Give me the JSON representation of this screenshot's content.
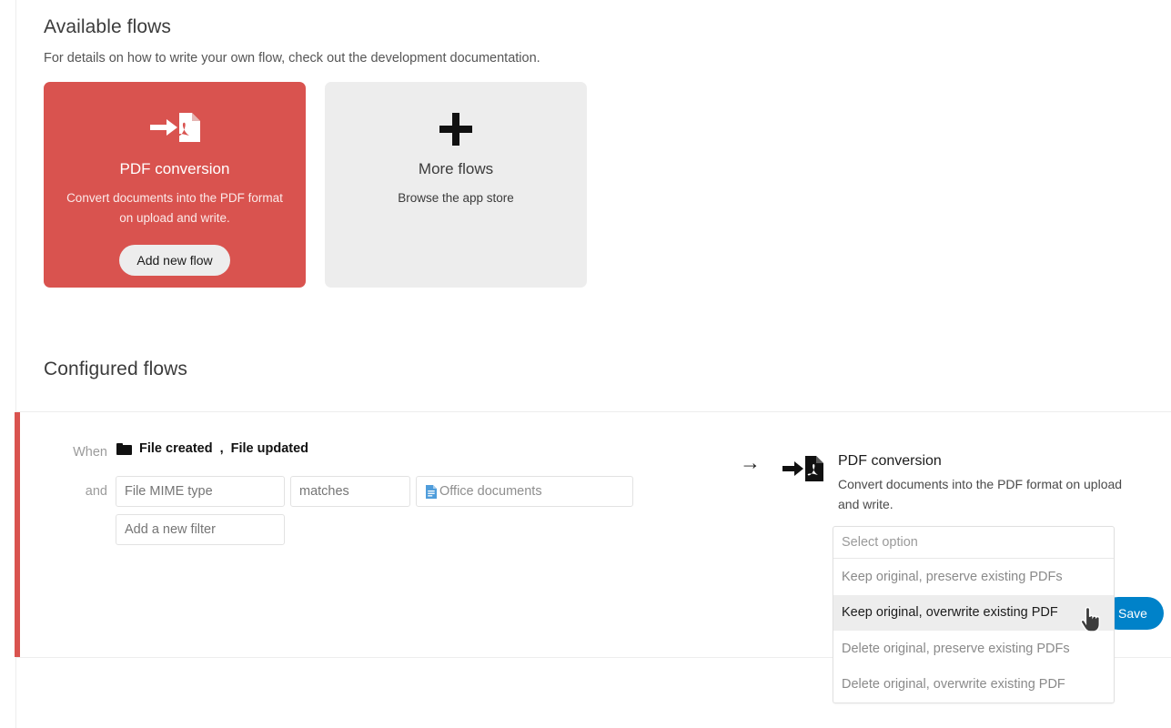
{
  "available": {
    "title": "Available flows",
    "subtitle": "For details on how to write your own flow, check out the development documentation.",
    "cards": [
      {
        "icon": "pdf-conversion-icon",
        "title": "PDF conversion",
        "desc": "Convert documents into the PDF format on upload and write.",
        "button": "Add new flow",
        "color": "#d9534f"
      },
      {
        "icon": "plus-icon",
        "title": "More flows",
        "desc": "Browse the app store",
        "color": "#ededed"
      }
    ]
  },
  "configured": {
    "title": "Configured flows",
    "flow": {
      "accent_color": "#d9534f",
      "when_label": "When",
      "and_label": "and",
      "trigger_icon": "folder-icon",
      "triggers": [
        "File created",
        "File updated"
      ],
      "trigger_separator": ",",
      "filters": [
        {
          "field_value": "",
          "field_placeholder": "File MIME type",
          "operator_value": "",
          "operator_placeholder": "matches",
          "value_icon": "office-document-icon",
          "value_text": "Office documents"
        }
      ],
      "new_filter_placeholder": "Add a new filter",
      "arrow": "→",
      "action": {
        "icon": "pdf-conversion-icon",
        "title": "PDF conversion",
        "desc": "Convert documents into the PDF format on upload and write.",
        "select": {
          "value": "",
          "placeholder": "Select option",
          "options": [
            "Keep original, preserve existing PDFs",
            "Keep original, overwrite existing PDF",
            "Delete original, preserve existing PDFs",
            "Delete original, overwrite existing PDF"
          ],
          "highlighted_index": 1
        }
      },
      "save_label": "Save",
      "save_color": "#0082c9"
    }
  },
  "cursor": {
    "type": "pointer-hand-cursor"
  }
}
